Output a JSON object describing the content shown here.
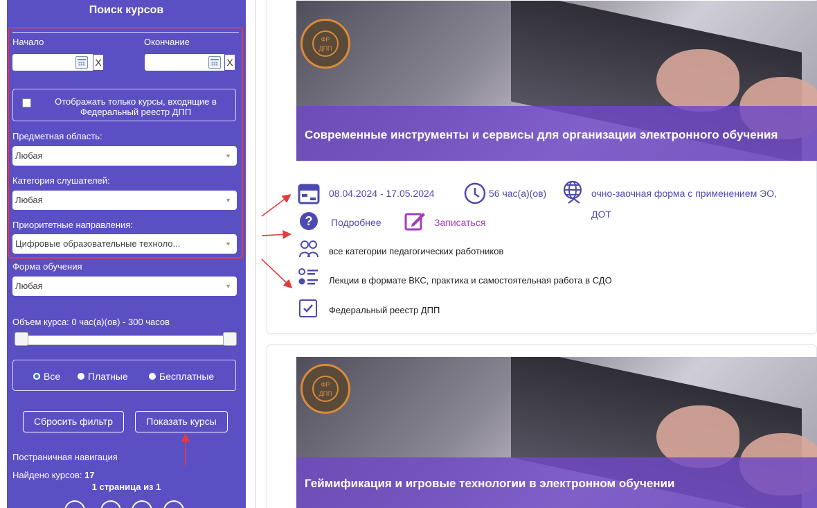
{
  "sidebar": {
    "title": "Поиск курсов",
    "start_label": "Начало",
    "end_label": "Окончание",
    "start_value": "",
    "end_value": "",
    "clear_symbol": "X",
    "reestr_checkbox_label": "Отображать только курсы, входящие в Федеральный реестр ДПП",
    "subject_label": "Предметная область:",
    "subject_value": "Любая",
    "category_label": "Категория слушателей:",
    "category_value": "Любая",
    "priority_label": "Приоритетные направления:",
    "priority_value": "Цифровые образовательные техноло...",
    "form_label": "Форма обучения",
    "form_value": "Любая",
    "volume_label": "Объем курса: 0 час(а)(ов) - 300 часов",
    "volume_range": [
      0,
      300
    ],
    "payment_options": [
      "Все",
      "Платные",
      "Бесплатные"
    ],
    "payment_selected": "Все",
    "reset_button": "Сбросить фильтр",
    "show_button": "Показать курсы",
    "pagination_label": "Постраничная навигация",
    "found_label": "Найдено курсов:",
    "found_count": "17",
    "page_info": "1 страница из 1"
  },
  "cards": [
    {
      "title": "Современные инструменты и сервисы для организации электронного обучения",
      "stamp_text": "ФР ДПП",
      "dates": "08.04.2024 - 17.05.2024",
      "hours": "56 час(а)(ов)",
      "form_line1": "очно-заочная форма с применением ЭО,",
      "form_line2": "ДОТ",
      "more_link": "Подробнее",
      "enroll_link": "Записаться",
      "audience": "все категории педагогических работников",
      "format": "Лекции в формате ВКС, практика и самостоятельная работа в СДО",
      "registry": "Федеральный реестр ДПП"
    },
    {
      "title": "Геймификация и игровые технологии в электронном обучении",
      "stamp_text": "ФР ДПП"
    }
  ],
  "colors": {
    "sidebar_bg": "#5b4fc4",
    "annotation_red": "#e43b3b",
    "link_blue": "#4c4ab0",
    "link_purple": "#a43db8",
    "overlay_purple": "#6e48c4"
  }
}
